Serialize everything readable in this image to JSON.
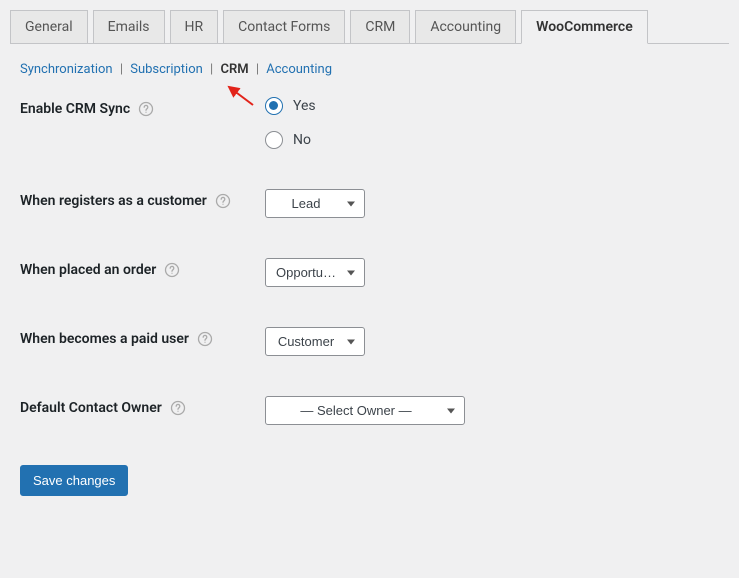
{
  "tabs": [
    {
      "label": "General"
    },
    {
      "label": "Emails"
    },
    {
      "label": "HR"
    },
    {
      "label": "Contact Forms"
    },
    {
      "label": "CRM"
    },
    {
      "label": "Accounting"
    },
    {
      "label": "WooCommerce",
      "active": true
    }
  ],
  "subnav": [
    {
      "label": "Synchronization"
    },
    {
      "label": "Subscription"
    },
    {
      "label": "CRM",
      "active": true
    },
    {
      "label": "Accounting"
    }
  ],
  "fields": {
    "enable_crm": {
      "label": "Enable CRM Sync",
      "yes": "Yes",
      "no": "No",
      "value": "yes"
    },
    "register_customer": {
      "label": "When registers as a customer",
      "value": "Lead"
    },
    "placed_order": {
      "label": "When placed an order",
      "value": "Opportu…"
    },
    "paid_user": {
      "label": "When becomes a paid user",
      "value": "Customer"
    },
    "default_owner": {
      "label": "Default Contact Owner",
      "value": "— Select Owner —"
    }
  },
  "save_button": "Save changes"
}
